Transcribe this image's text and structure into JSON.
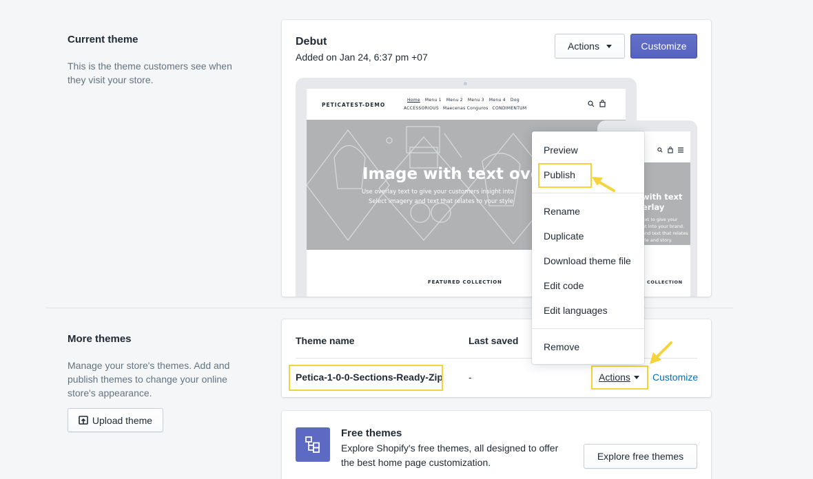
{
  "current_theme": {
    "heading": "Current theme",
    "description": "This is the theme customers see when they visit your store.",
    "name": "Debut",
    "added": "Added on Jan 24, 6:37 pm +07",
    "actions_label": "Actions",
    "customize_label": "Customize"
  },
  "preview": {
    "store_name": "PETICATEST-DEMO",
    "nav_row1": [
      "Home",
      "Menu 1",
      "Menu 2",
      "Menu 3",
      "Menu 4",
      "Dog"
    ],
    "nav_row2": [
      "ACCESSORIOUS",
      "Maecenas Conguros",
      "CONDIMENTUM"
    ],
    "hero_title": "Image with text ove",
    "hero_line1": "Use overlay text to give your customers insight into",
    "hero_line2": "Select imagery and text that relates to your style",
    "featured": "FEATURED COLLECTION",
    "mobile_hero_title1": "with text",
    "mobile_hero_title2": "erlay",
    "mobile_hero_lines": [
      "ext to give your",
      "ht into your brand.",
      "and text that relates",
      "yle and story."
    ],
    "mobile_featured": "COLLECTION"
  },
  "actions_menu": {
    "items": [
      "Preview",
      "Publish",
      "Rename",
      "Duplicate",
      "Download theme file",
      "Edit code",
      "Edit languages",
      "Remove"
    ]
  },
  "more_themes": {
    "heading": "More themes",
    "description": "Manage your store's themes. Add and publish themes to change your online store's appearance.",
    "upload_label": "Upload theme",
    "col_name": "Theme name",
    "col_saved": "Last saved",
    "row": {
      "name": "Petica-1-0-0-Sections-Ready-Zip",
      "saved": "-",
      "actions_label": "Actions",
      "customize_label": "Customize"
    }
  },
  "free_themes": {
    "title": "Free themes",
    "description": "Explore Shopify's free themes, all designed to offer the best home page customization.",
    "button_label": "Explore free themes"
  },
  "colors": {
    "primary": "#5c6ac4",
    "highlight": "#f5d33d",
    "link": "#006fbb"
  }
}
